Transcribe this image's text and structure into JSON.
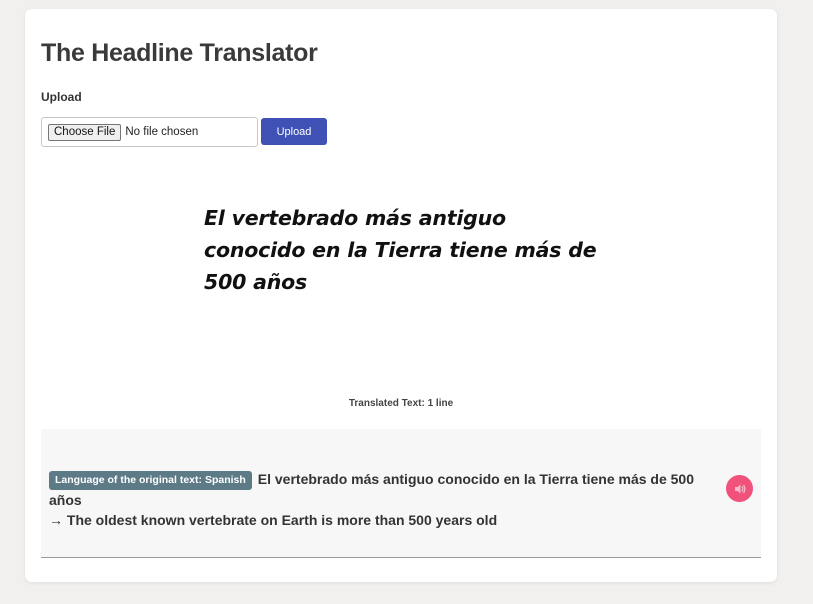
{
  "app": {
    "title": "The Headline Translator"
  },
  "upload": {
    "label": "Upload",
    "choose_file_label": "Choose File",
    "file_status": "No file chosen",
    "upload_button_label": "Upload"
  },
  "headline_image": {
    "lines": [
      "El vertebrado más antiguo",
      "conocido en la Tierra tiene más de",
      "500 años"
    ]
  },
  "translation": {
    "count_text": "Translated Text: 1 line",
    "language_prefix": "Language of the original text:",
    "language": "Spanish",
    "original_text": "El vertebrado más antiguo conocido en la Tierra tiene más de 500 años",
    "arrow": "→",
    "translated_text": "The oldest known vertebrate on Earth is more than 500 years old",
    "speak_icon": "speaker-icon"
  },
  "colors": {
    "background": "#f1f0ef",
    "upload_button": "#3f51b5",
    "language_badge": "#5d7a87",
    "speak_button": "#f0527c"
  }
}
